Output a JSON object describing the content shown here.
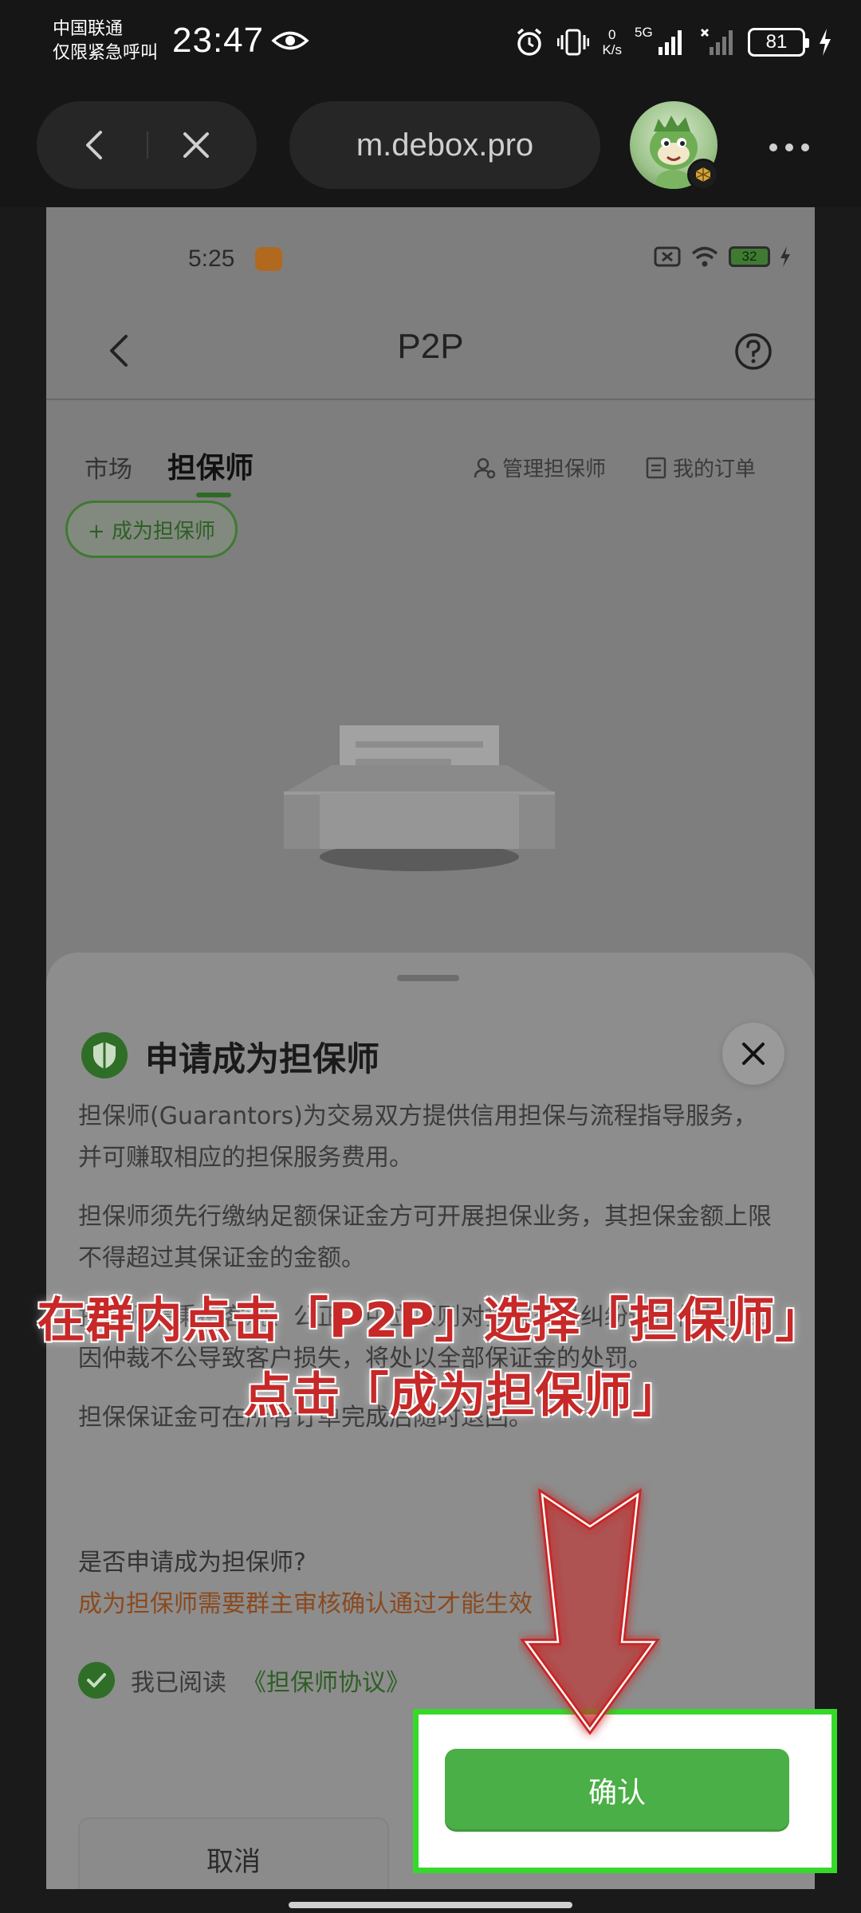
{
  "os_status": {
    "carrier_line1": "中国联通",
    "carrier_line2": "仅限紧急呼叫",
    "time": "23:47",
    "net_speed_value": "0",
    "net_speed_unit": "K/s",
    "signal_label": "5G",
    "battery": "81"
  },
  "browser": {
    "url": "m.debox.pro"
  },
  "inner_app": {
    "status_time": "5:25",
    "battery": "32",
    "title": "P2P",
    "tabs": {
      "market": "市场",
      "guarantor": "担保师",
      "manage": "管理担保师",
      "orders": "我的订单"
    },
    "become_button": "+ 成为担保师"
  },
  "sheet": {
    "title": "申请成为担保师",
    "paragraphs": [
      "担保师(Guarantors)为交易双方提供信用担保与流程指导服务，并可赚取相应的担保服务费用。",
      "担保师须先行缴纳足额保证金方可开展担保业务，其担保金额上限不得超过其保证金的金额。",
      "担保师需秉持客观、公正、中立原则对担保交易纠纷进行仲裁。如因仲裁不公导致客户损失，将处以全部保证金的处罚。",
      "担保保证金可在所有订单完成后随时退回。"
    ],
    "question": "是否申请成为担保师?",
    "warning": "成为担保师需要群主审核确认通过才能生效",
    "agree_text": "我已阅读",
    "agree_link": "《担保师协议》",
    "cancel": "取消",
    "confirm": "确认"
  },
  "overlay": {
    "caption_line1": "在群内点击「P2P」选择「担保师」",
    "caption_line2": "点击「成为担保师」"
  },
  "colors": {
    "accent_green": "#4aaf46",
    "highlight_frame": "#36d82b",
    "caption_red": "#c72828"
  }
}
